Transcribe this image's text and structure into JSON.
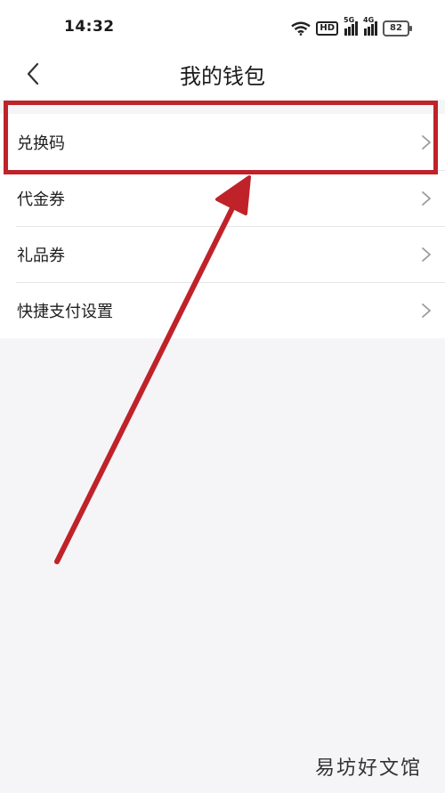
{
  "status_bar": {
    "time": "14:32",
    "hd_label": "HD",
    "signal_1_label": "5G",
    "signal_2_label": "4G",
    "battery_level": "82"
  },
  "header": {
    "title": "我的钱包",
    "back_icon": "chevron-left-icon"
  },
  "menu": {
    "items": [
      {
        "label": "兑换码",
        "icon": "chevron-right-icon"
      },
      {
        "label": "代金券",
        "icon": "chevron-right-icon"
      },
      {
        "label": "礼品券",
        "icon": "chevron-right-icon"
      },
      {
        "label": "快捷支付设置",
        "icon": "chevron-right-icon"
      }
    ]
  },
  "annotation": {
    "highlight_color": "#c0222a",
    "highlighted_item": "兑换码"
  },
  "watermark": "易坊好文馆"
}
